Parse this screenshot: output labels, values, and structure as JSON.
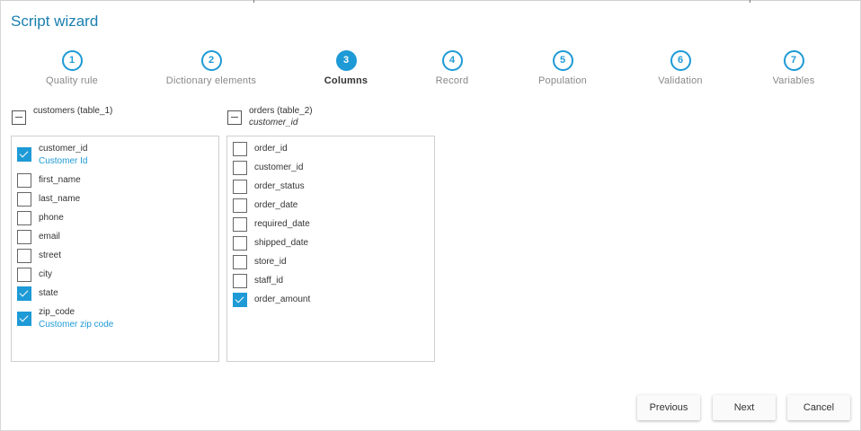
{
  "window": {
    "title": "Script wizard"
  },
  "steps": [
    {
      "number": "1",
      "label": "Quality rule"
    },
    {
      "number": "2",
      "label": "Dictionary elements"
    },
    {
      "number": "3",
      "label": "Columns",
      "active": true
    },
    {
      "number": "4",
      "label": "Record"
    },
    {
      "number": "5",
      "label": "Population"
    },
    {
      "number": "6",
      "label": "Validation"
    },
    {
      "number": "7",
      "label": "Variables"
    }
  ],
  "tables": [
    {
      "title": "customers (table_1)",
      "subtitle": "",
      "columns": [
        {
          "name": "customer_id",
          "description": "Customer Id",
          "checked": true
        },
        {
          "name": "first_name",
          "checked": false
        },
        {
          "name": "last_name",
          "checked": false
        },
        {
          "name": "phone",
          "checked": false
        },
        {
          "name": "email",
          "checked": false
        },
        {
          "name": "street",
          "checked": false
        },
        {
          "name": "city",
          "checked": false
        },
        {
          "name": "state",
          "checked": true
        },
        {
          "name": "zip_code",
          "description": "Customer zip code",
          "checked": true
        }
      ]
    },
    {
      "title": "orders (table_2)",
      "subtitle": "customer_id",
      "columns": [
        {
          "name": "order_id",
          "checked": false
        },
        {
          "name": "customer_id",
          "checked": false
        },
        {
          "name": "order_status",
          "checked": false
        },
        {
          "name": "order_date",
          "checked": false
        },
        {
          "name": "required_date",
          "checked": false
        },
        {
          "name": "shipped_date",
          "checked": false
        },
        {
          "name": "store_id",
          "checked": false
        },
        {
          "name": "staff_id",
          "checked": false
        },
        {
          "name": "order_amount",
          "checked": true
        }
      ]
    }
  ],
  "buttons": {
    "previous": "Previous",
    "next": "Next",
    "cancel": "Cancel"
  },
  "colors": {
    "accent": "#1e9ad6",
    "title": "#1a7fb0"
  }
}
